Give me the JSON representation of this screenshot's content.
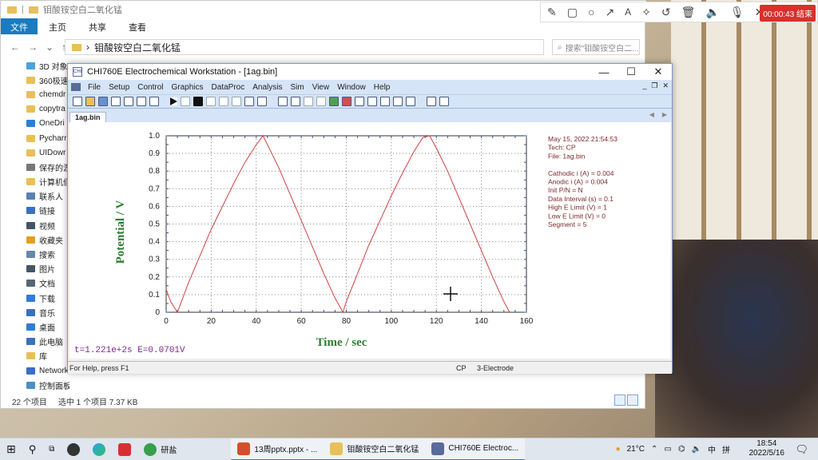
{
  "explorer": {
    "title": "钼酸铵空白二氧化锰",
    "ribbon_tabs": [
      "文件",
      "主页",
      "共享",
      "查看"
    ],
    "address": "钼酸铵空白二氧化锰",
    "search_placeholder": "搜索\"钼酸铵空白二...",
    "nav_items": [
      {
        "label": "3D 对象",
        "color": "#4aa3df"
      },
      {
        "label": "360极速",
        "color": "#e8c05a"
      },
      {
        "label": "chemdr",
        "color": "#e8c05a"
      },
      {
        "label": "copytra",
        "color": "#e8c05a"
      },
      {
        "label": "OneDri",
        "color": "#2f7dd6"
      },
      {
        "label": "Pycharr",
        "color": "#e8c05a"
      },
      {
        "label": "UIDowr",
        "color": "#e8c05a"
      },
      {
        "label": "保存的游",
        "color": "#777777"
      },
      {
        "label": "计算机们",
        "color": "#e8c05a"
      },
      {
        "label": "联系人",
        "color": "#5a7fb0"
      },
      {
        "label": "链接",
        "color": "#3a70c0"
      },
      {
        "label": "视频",
        "color": "#445566"
      },
      {
        "label": "收藏夹",
        "color": "#e0a020"
      },
      {
        "label": "搜索",
        "color": "#6688aa"
      },
      {
        "label": "图片",
        "color": "#445566"
      },
      {
        "label": "文档",
        "color": "#556677"
      },
      {
        "label": "下载",
        "color": "#2f7dd6"
      },
      {
        "label": "音乐",
        "color": "#3a70c0"
      },
      {
        "label": "桌面",
        "color": "#2f7dd6"
      },
      {
        "label": "此电脑",
        "color": "#3a70c0"
      },
      {
        "label": "库",
        "color": "#e8c05a"
      },
      {
        "label": "Network",
        "color": "#3a70c0"
      },
      {
        "label": "控制面板",
        "color": "#4a90c0"
      }
    ],
    "status_count": "22 个项目",
    "status_selected": "选中 1 个项目  7.37 KB"
  },
  "chi": {
    "title": "CHI760E Electrochemical Workstation - [1ag.bin]",
    "logo": "CHI",
    "menu": [
      "File",
      "Setup",
      "Control",
      "Graphics",
      "DataProc",
      "Analysis",
      "Sim",
      "View",
      "Window",
      "Help"
    ],
    "tab": "1ag.bin",
    "status_help": "For Help, press F1",
    "status_tech": "CP",
    "status_electrode": "3-Electrode",
    "readout": "t=1.221e+2s  E=0.0701V"
  },
  "chart_data": {
    "type": "line",
    "xlabel": "Time / sec",
    "ylabel": "Potential / V",
    "xlim": [
      0,
      160
    ],
    "ylim": [
      0,
      1.0
    ],
    "x_ticks": [
      "0",
      "20",
      "40",
      "60",
      "80",
      "100",
      "120",
      "140",
      "160"
    ],
    "y_ticks": [
      "0",
      "0.1",
      "0.2",
      "0.3",
      "0.4",
      "0.5",
      "0.6",
      "0.7",
      "0.8",
      "0.9",
      "1.0"
    ],
    "grid": "dotted",
    "color": "#d04040",
    "series": [
      {
        "x": [
          0,
          2,
          4,
          5,
          10,
          15,
          20,
          25,
          30,
          35,
          40,
          43,
          45,
          50,
          55,
          60,
          65,
          70,
          75,
          78.5,
          80,
          85,
          90,
          95,
          100,
          105,
          110,
          114,
          117,
          120,
          125,
          130,
          135,
          140,
          145,
          150,
          152.5
        ],
        "y": [
          0.13,
          0.06,
          0.02,
          0,
          0.17,
          0.32,
          0.47,
          0.6,
          0.73,
          0.85,
          0.95,
          1.0,
          0.95,
          0.82,
          0.67,
          0.52,
          0.37,
          0.22,
          0.08,
          0,
          0.06,
          0.22,
          0.38,
          0.52,
          0.66,
          0.79,
          0.91,
          0.99,
          1.0,
          0.93,
          0.8,
          0.65,
          0.5,
          0.35,
          0.2,
          0.06,
          0
        ]
      }
    ],
    "annotations": [
      "May 15, 2022   21:54:53",
      "Tech: CP",
      "File: 1ag.bin",
      "",
      "Cathodic i (A) = 0.004",
      "Anodic i (A) = 0.004",
      "Init P/N = N",
      "Data Interval (s) = 0.1",
      "High E Limit (V) = 1",
      "Low E Limit (V) = 0",
      "Segment = 5"
    ]
  },
  "recorder": {
    "time": "00:00:43 结束"
  },
  "taskbar": {
    "items": [
      {
        "label": "研盐",
        "color": "#3a9e4a"
      },
      {
        "label": "13周pptx.pptx - ...",
        "color": "#d0502e"
      },
      {
        "label": "钼酸铵空白二氧化锰",
        "color": "#e8c05a"
      },
      {
        "label": "CHI760E Electroc...",
        "color": "#5a6a9a"
      }
    ],
    "weather": "21°C",
    "ime": "中",
    "ime2": "拼",
    "time": "18:54",
    "date": "2022/5/16"
  }
}
